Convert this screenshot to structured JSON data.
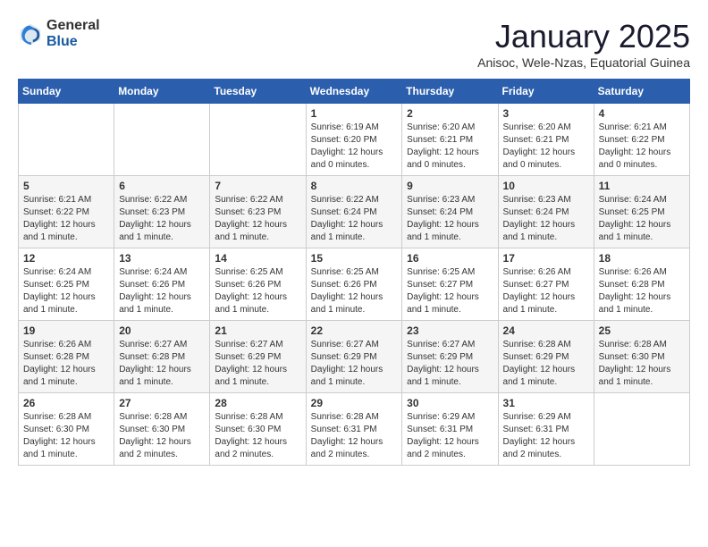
{
  "header": {
    "logo": {
      "line1": "General",
      "line2": "Blue"
    },
    "title": "January 2025",
    "subtitle": "Anisoc, Wele-Nzas, Equatorial Guinea"
  },
  "weekdays": [
    "Sunday",
    "Monday",
    "Tuesday",
    "Wednesday",
    "Thursday",
    "Friday",
    "Saturday"
  ],
  "weeks": [
    [
      {
        "day": "",
        "info": ""
      },
      {
        "day": "",
        "info": ""
      },
      {
        "day": "",
        "info": ""
      },
      {
        "day": "1",
        "info": "Sunrise: 6:19 AM\nSunset: 6:20 PM\nDaylight: 12 hours and 0 minutes."
      },
      {
        "day": "2",
        "info": "Sunrise: 6:20 AM\nSunset: 6:21 PM\nDaylight: 12 hours and 0 minutes."
      },
      {
        "day": "3",
        "info": "Sunrise: 6:20 AM\nSunset: 6:21 PM\nDaylight: 12 hours and 0 minutes."
      },
      {
        "day": "4",
        "info": "Sunrise: 6:21 AM\nSunset: 6:22 PM\nDaylight: 12 hours and 0 minutes."
      }
    ],
    [
      {
        "day": "5",
        "info": "Sunrise: 6:21 AM\nSunset: 6:22 PM\nDaylight: 12 hours and 1 minute."
      },
      {
        "day": "6",
        "info": "Sunrise: 6:22 AM\nSunset: 6:23 PM\nDaylight: 12 hours and 1 minute."
      },
      {
        "day": "7",
        "info": "Sunrise: 6:22 AM\nSunset: 6:23 PM\nDaylight: 12 hours and 1 minute."
      },
      {
        "day": "8",
        "info": "Sunrise: 6:22 AM\nSunset: 6:24 PM\nDaylight: 12 hours and 1 minute."
      },
      {
        "day": "9",
        "info": "Sunrise: 6:23 AM\nSunset: 6:24 PM\nDaylight: 12 hours and 1 minute."
      },
      {
        "day": "10",
        "info": "Sunrise: 6:23 AM\nSunset: 6:24 PM\nDaylight: 12 hours and 1 minute."
      },
      {
        "day": "11",
        "info": "Sunrise: 6:24 AM\nSunset: 6:25 PM\nDaylight: 12 hours and 1 minute."
      }
    ],
    [
      {
        "day": "12",
        "info": "Sunrise: 6:24 AM\nSunset: 6:25 PM\nDaylight: 12 hours and 1 minute."
      },
      {
        "day": "13",
        "info": "Sunrise: 6:24 AM\nSunset: 6:26 PM\nDaylight: 12 hours and 1 minute."
      },
      {
        "day": "14",
        "info": "Sunrise: 6:25 AM\nSunset: 6:26 PM\nDaylight: 12 hours and 1 minute."
      },
      {
        "day": "15",
        "info": "Sunrise: 6:25 AM\nSunset: 6:26 PM\nDaylight: 12 hours and 1 minute."
      },
      {
        "day": "16",
        "info": "Sunrise: 6:25 AM\nSunset: 6:27 PM\nDaylight: 12 hours and 1 minute."
      },
      {
        "day": "17",
        "info": "Sunrise: 6:26 AM\nSunset: 6:27 PM\nDaylight: 12 hours and 1 minute."
      },
      {
        "day": "18",
        "info": "Sunrise: 6:26 AM\nSunset: 6:28 PM\nDaylight: 12 hours and 1 minute."
      }
    ],
    [
      {
        "day": "19",
        "info": "Sunrise: 6:26 AM\nSunset: 6:28 PM\nDaylight: 12 hours and 1 minute."
      },
      {
        "day": "20",
        "info": "Sunrise: 6:27 AM\nSunset: 6:28 PM\nDaylight: 12 hours and 1 minute."
      },
      {
        "day": "21",
        "info": "Sunrise: 6:27 AM\nSunset: 6:29 PM\nDaylight: 12 hours and 1 minute."
      },
      {
        "day": "22",
        "info": "Sunrise: 6:27 AM\nSunset: 6:29 PM\nDaylight: 12 hours and 1 minute."
      },
      {
        "day": "23",
        "info": "Sunrise: 6:27 AM\nSunset: 6:29 PM\nDaylight: 12 hours and 1 minute."
      },
      {
        "day": "24",
        "info": "Sunrise: 6:28 AM\nSunset: 6:29 PM\nDaylight: 12 hours and 1 minute."
      },
      {
        "day": "25",
        "info": "Sunrise: 6:28 AM\nSunset: 6:30 PM\nDaylight: 12 hours and 1 minute."
      }
    ],
    [
      {
        "day": "26",
        "info": "Sunrise: 6:28 AM\nSunset: 6:30 PM\nDaylight: 12 hours and 1 minute."
      },
      {
        "day": "27",
        "info": "Sunrise: 6:28 AM\nSunset: 6:30 PM\nDaylight: 12 hours and 2 minutes."
      },
      {
        "day": "28",
        "info": "Sunrise: 6:28 AM\nSunset: 6:30 PM\nDaylight: 12 hours and 2 minutes."
      },
      {
        "day": "29",
        "info": "Sunrise: 6:28 AM\nSunset: 6:31 PM\nDaylight: 12 hours and 2 minutes."
      },
      {
        "day": "30",
        "info": "Sunrise: 6:29 AM\nSunset: 6:31 PM\nDaylight: 12 hours and 2 minutes."
      },
      {
        "day": "31",
        "info": "Sunrise: 6:29 AM\nSunset: 6:31 PM\nDaylight: 12 hours and 2 minutes."
      },
      {
        "day": "",
        "info": ""
      }
    ]
  ]
}
